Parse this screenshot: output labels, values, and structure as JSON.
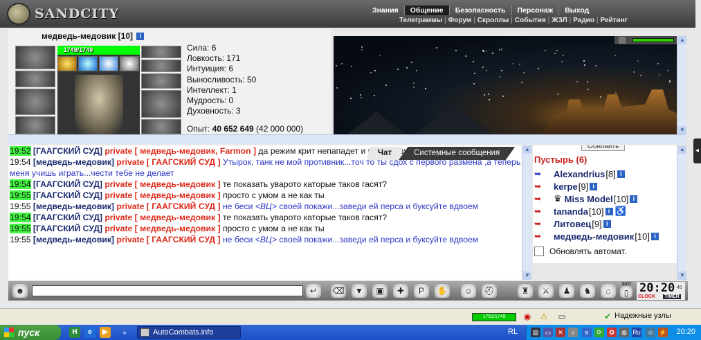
{
  "logo": {
    "text": "SANDCITY"
  },
  "menu_main": [
    "Знания",
    "Общение",
    "Безопасность",
    "Персонаж",
    "Выход"
  ],
  "menu_main_active": "Общение",
  "menu_sub": [
    "Телеграммы",
    "Форум",
    "Скроллы",
    "События",
    "ЖЗЛ",
    "Радио",
    "Рейтинг"
  ],
  "character": {
    "name": "медведь-медовик",
    "level": "[10]",
    "hp_text": "1749/1749",
    "hp_fraction": 1.0,
    "stats": [
      "Сила: 6",
      "Ловкость: 171",
      "Интуиция: 6",
      "Выносливость: 50",
      "Интеллект: 1",
      "Мудрость: 0",
      "Духовность: 3"
    ],
    "exp_label": "Опыт:",
    "exp_value": "40 652 649",
    "exp_next": "(42 000 000)"
  },
  "chat_tabs": {
    "chat": "Чат",
    "system": "Системные сообщения"
  },
  "chat_messages": [
    {
      "time": "19:52",
      "hl": true,
      "sender": "[ГААГСКИЙ СУД]",
      "private": "private [ медведь-медовик, Farmon ]",
      "text": " да режим крит непападет и на него дух просрал )))",
      "color": "dark"
    },
    {
      "time": "19:54",
      "hl": false,
      "sender": "[медведь-медовик]",
      "private": "private [ ГААГСКИЙ СУД ]",
      "text": " Утырок, танк не мой противник...точ то ты сдох с первого размена ,а теперь меня учишь играть...чести тебе не делает",
      "color": "blue"
    },
    {
      "time": "19:54",
      "hl": true,
      "sender": "[ГААГСКИЙ СУД]",
      "private": "private [ медведь-медовик ]",
      "text": " те показать уварото каторые таков гасят?",
      "color": "dark"
    },
    {
      "time": "19:55",
      "hl": true,
      "sender": "[ГААГСКИЙ СУД]",
      "private": "private [ медведь-медовик ]",
      "text": " просто с умом а не как ты",
      "color": "dark"
    },
    {
      "time": "19:55",
      "hl": false,
      "sender": "[медведь-медовик]",
      "private": "private [ ГААГСКИЙ СУД ]",
      "text_pre": " не беси ",
      "text_vc": "<ВЦ>",
      "text_post": " своей покажи...заведи ей перса и буксуйте вдвоем",
      "color": "blue"
    },
    {
      "time": "19:54",
      "hl": true,
      "sender": "[ГААГСКИЙ СУД]",
      "private": "private [ медведь-медовик ]",
      "text": " те показать уварото каторые таков гасят?",
      "color": "dark"
    },
    {
      "time": "19:55",
      "hl": true,
      "sender": "[ГААГСКИЙ СУД]",
      "private": "private [ медведь-медовик ]",
      "text": " просто с умом а не как ты",
      "color": "dark"
    },
    {
      "time": "19:55",
      "hl": false,
      "sender": "[медведь-медовик]",
      "private": "private [ ГААГСКИЙ СУД ]",
      "text_pre": " не беси ",
      "text_vc": "<ВЦ>",
      "text_post": " своей покажи...заведи ей перса и буксуйте вдвоем",
      "color": "blue"
    }
  ],
  "users_panel": {
    "refresh_label": "Обновить",
    "room_title": "Пустырь (6)",
    "users": [
      {
        "name": "Alexandrius",
        "level": "[8]",
        "arrow": "blue"
      },
      {
        "name": "kerpe",
        "level": "[9]",
        "arrow": "red"
      },
      {
        "name": "Miss Model",
        "level": "[10]",
        "arrow": "red",
        "glyph_before": "♛"
      },
      {
        "name": "tananda",
        "level": "[10]",
        "arrow": "red",
        "glyph_after": "♿"
      },
      {
        "name": "Литовец",
        "level": "[9]",
        "arrow": "red"
      },
      {
        "name": "медведь-медовик",
        "level": "[10]",
        "arrow": "red"
      }
    ],
    "auto_refresh_label": "Обновлять автомат."
  },
  "toolbar": {
    "clock_time": "20:20",
    "clock_sec": "45",
    "clock_label": "CLOCK",
    "timer_label": "TIMER",
    "exit_label": "EXIT"
  },
  "statusbar": {
    "hp": "1751/1749",
    "zone": "Надежные узлы"
  },
  "taskbar": {
    "start": "пуск",
    "window": "AutoCombats.info",
    "lang": "RL",
    "time": "20:20"
  },
  "colors": {
    "private": "#dd2a1a",
    "sender": "#1b2a70",
    "message_blue": "#2d36c4",
    "time_highlight": "#42f742",
    "hp": "#00ff00",
    "taskbar": "#1d4fc6"
  }
}
